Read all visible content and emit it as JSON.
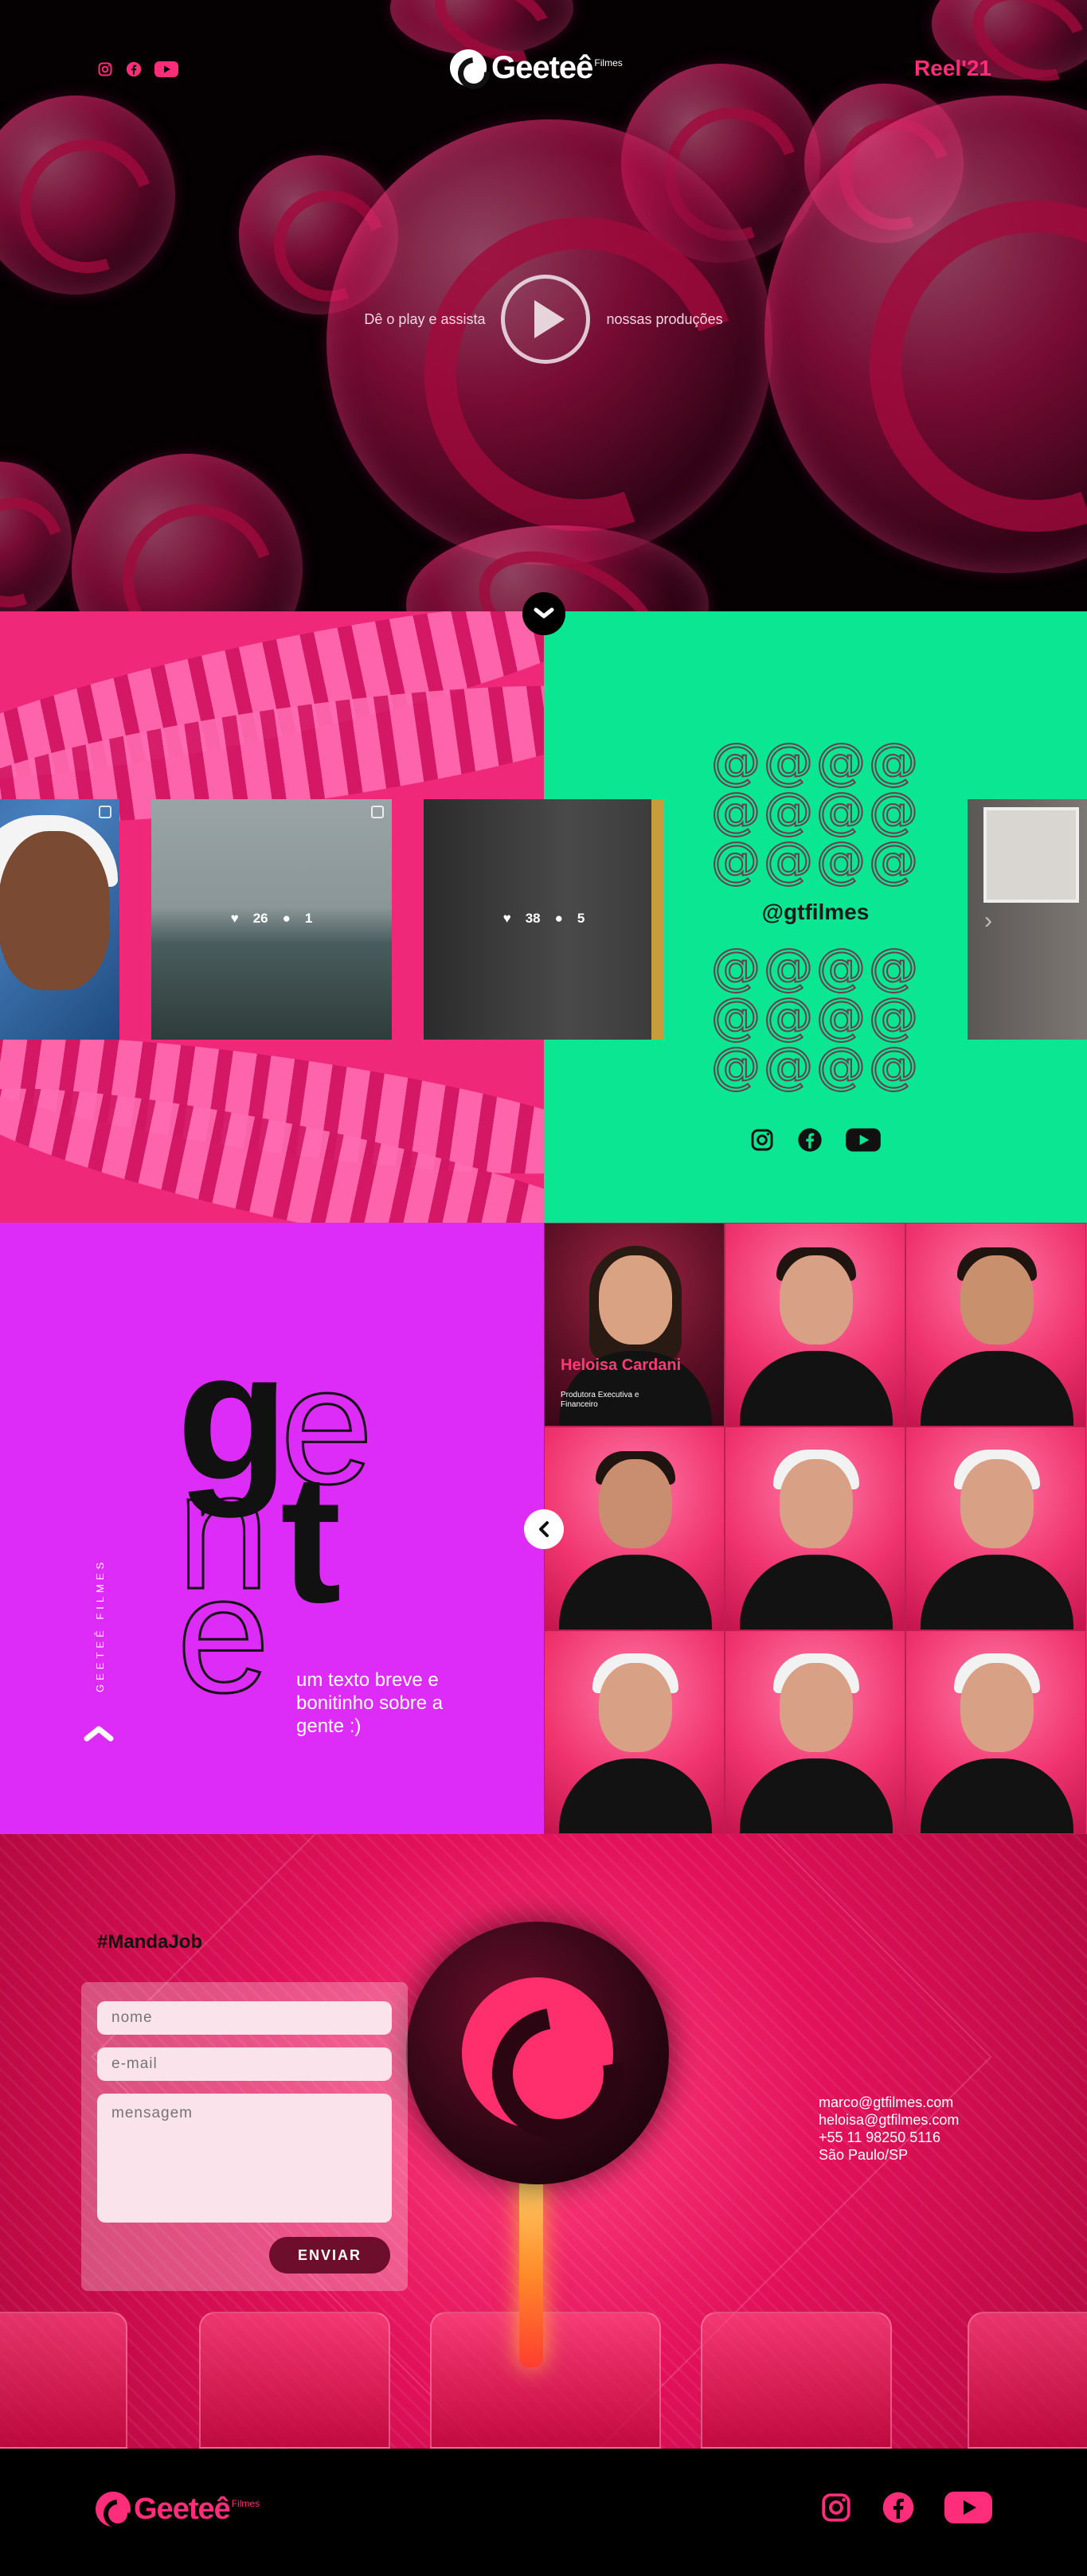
{
  "header": {
    "logo_text": "Geeteê",
    "logo_sub": "Filmes",
    "reel_label": "Reel'21",
    "social_icons": [
      "instagram-icon",
      "facebook-icon",
      "youtube-icon"
    ]
  },
  "hero": {
    "play_left": "Dê o play e assista",
    "play_right": "nossas produções"
  },
  "instagram": {
    "handle": "@gtfilmes",
    "at_row": "@@@@",
    "posts": [
      {
        "likes": "",
        "comments": ""
      },
      {
        "likes": "26",
        "comments": "1"
      },
      {
        "likes": "38",
        "comments": "5"
      },
      {
        "likes": "",
        "comments": ""
      }
    ],
    "social_icons": [
      "instagram-icon",
      "facebook-icon",
      "youtube-icon"
    ]
  },
  "gente": {
    "vertical_label": "GEETEÊ FILMES",
    "letters": {
      "g": "g",
      "e1": "e",
      "n": "n",
      "t": "t",
      "e2": "e"
    },
    "text": "um texto breve e bonitinho sobre a gente :)",
    "featured_name": "Heloisa Cardani",
    "featured_role": "Produtora Executiva e Financeiro"
  },
  "contact": {
    "title": "#MandaJob",
    "name_placeholder": "nome",
    "email_placeholder": "e-mail",
    "message_placeholder": "mensagem",
    "send_label": "ENVIAR",
    "email1": "marco@gtfilmes.com",
    "email2": "heloisa@gtfilmes.com",
    "phone": "+55 11 98250 5116",
    "city": "São Paulo/SP"
  },
  "footer": {
    "logo_text": "Geeteê",
    "logo_sub": "Filmes"
  },
  "colors": {
    "accent_pink": "#ff2d7a",
    "insta_green": "#0ae691",
    "gente_purple": "#dd2cf8"
  }
}
